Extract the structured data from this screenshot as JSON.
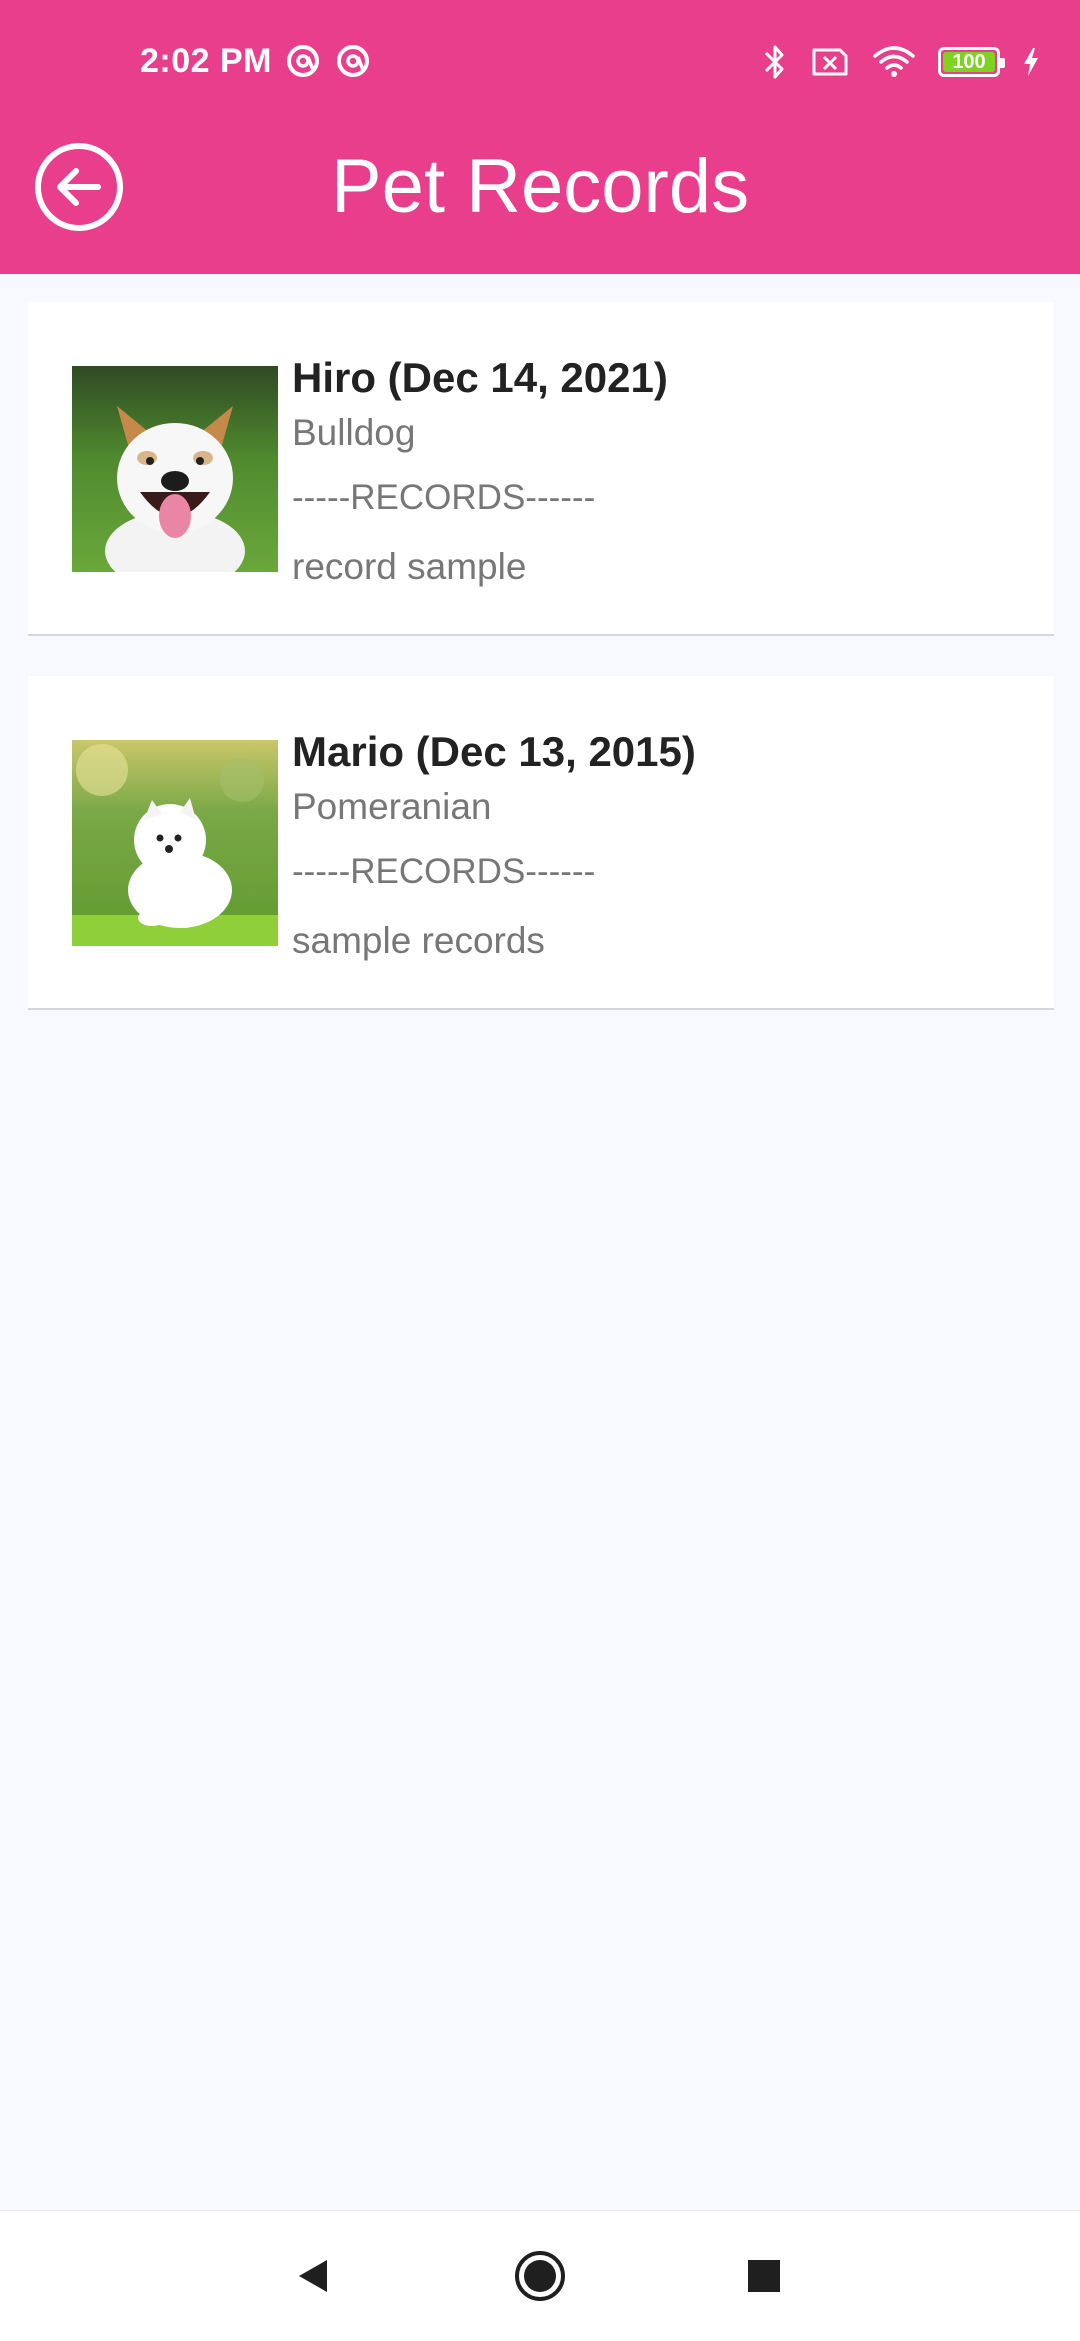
{
  "status_bar": {
    "time": "2:02 PM",
    "battery_level": "100",
    "icons": [
      "at-sign-icon",
      "at-sign-icon",
      "bluetooth-icon",
      "sim-off-icon",
      "wifi-icon",
      "battery-icon",
      "charging-icon"
    ],
    "battery_fill_color": "#7ed321"
  },
  "app_bar": {
    "title": "Pet Records",
    "back_icon": "back-arrow-circle-icon",
    "color": "#e83e8c"
  },
  "pets": [
    {
      "name": "Hiro (Dec 14, 2021)",
      "breed": "Bulldog",
      "divider": "-----RECORDS------",
      "notes": "record sample",
      "photo": "bulldog-photo"
    },
    {
      "name": "Mario (Dec 13, 2015)",
      "breed": "Pomeranian",
      "divider": "-----RECORDS------",
      "notes": "sample records",
      "photo": "pomeranian-photo"
    }
  ],
  "nav_bar": {
    "buttons": [
      "back-triangle-icon",
      "home-circle-icon",
      "recents-square-icon"
    ]
  }
}
